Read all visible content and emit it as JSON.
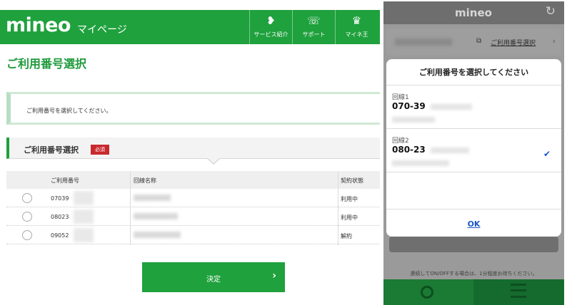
{
  "desktop": {
    "header": {
      "logo": "mineo",
      "subtitle": "マイページ",
      "nav": [
        {
          "label": "サービス紹介",
          "icon": "heart-leaf-icon",
          "glyph": "❥"
        },
        {
          "label": "サポート",
          "icon": "chat-icon",
          "glyph": "☏"
        },
        {
          "label": "マイネ王",
          "icon": "crown-icon",
          "glyph": "♛"
        }
      ]
    },
    "page_title": "ご利用番号選択",
    "notice": "ご利用番号を選択してください。",
    "section": {
      "title": "ご利用番号選択",
      "badge": "必須"
    },
    "table": {
      "headers": [
        "ご利用番号",
        "回線名称",
        "契約状態"
      ],
      "rows": [
        {
          "number": "07039",
          "status": "利用中"
        },
        {
          "number": "08023",
          "status": "利用中"
        },
        {
          "number": "09052",
          "status": "解約"
        }
      ]
    },
    "submit_label": "決定",
    "submit_chevron": "›"
  },
  "mobile": {
    "logo": "mineo",
    "refresh_glyph": "↻",
    "top_card": {
      "switch_glyph": "⧉",
      "select_label": "ご利用番号選択",
      "arrow": "›"
    },
    "modal": {
      "title": "ご利用番号を選択してください",
      "options": [
        {
          "label": "回線1",
          "number": "070-39"
        },
        {
          "label": "回線2",
          "number": "080-23",
          "selected": true
        }
      ],
      "check_glyph": "✔",
      "ok": "OK"
    },
    "note": "連続してON/OFFする場合は、1分程度お待ちください。"
  }
}
